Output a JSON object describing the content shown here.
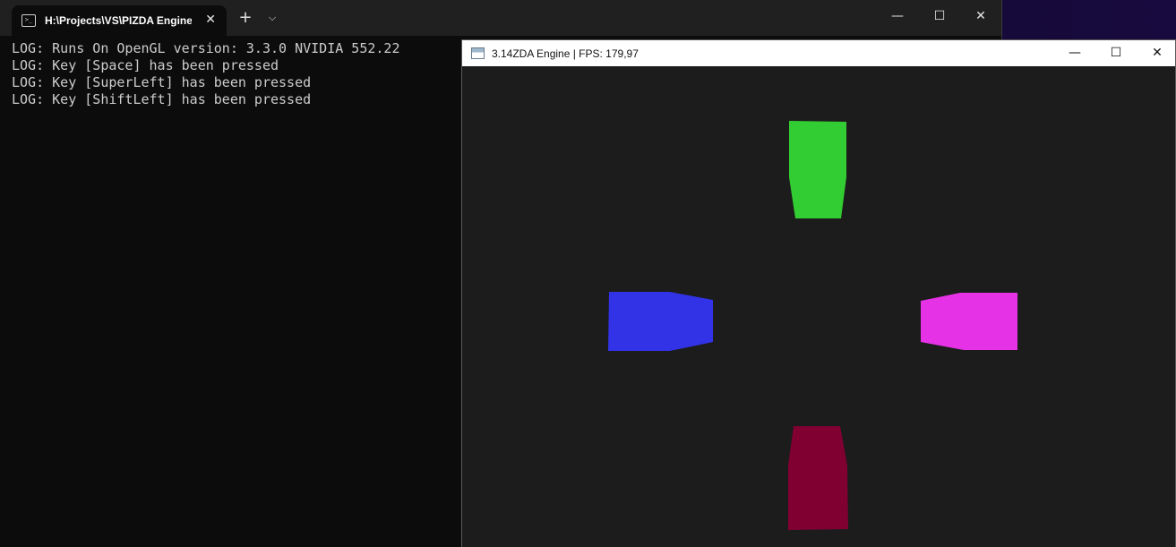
{
  "terminal": {
    "tab_title": "H:\\Projects\\VS\\PIZDA Engine\\",
    "tab_icon": "terminal-icon",
    "tab_close_glyph": "✕",
    "new_tab_glyph": "+",
    "dropdown_glyph": "⌵",
    "minimize_glyph": "—",
    "maximize_glyph": "☐",
    "close_glyph": "✕",
    "log_lines": [
      "LOG: Runs On OpenGL version: 3.3.0 NVIDIA 552.22",
      "LOG: Key [Space] has been pressed",
      "LOG: Key [SuperLeft] has been pressed",
      "LOG: Key [ShiftLeft] has been pressed"
    ]
  },
  "engine": {
    "title": "3.14ZDA Engine | FPS: 179,97",
    "minimize_glyph": "—",
    "maximize_glyph": "☐",
    "close_glyph": "✕",
    "shapes": [
      {
        "name": "green-shape",
        "color": "#32cd32"
      },
      {
        "name": "blue-shape",
        "color": "#3232e6"
      },
      {
        "name": "magenta-shape",
        "color": "#e632e6"
      },
      {
        "name": "maroon-shape",
        "color": "#800032"
      }
    ]
  },
  "colors": {
    "terminal_bg": "#0c0c0c",
    "terminal_text": "#cccccc",
    "viewport_bg": "#1c1c1c"
  }
}
